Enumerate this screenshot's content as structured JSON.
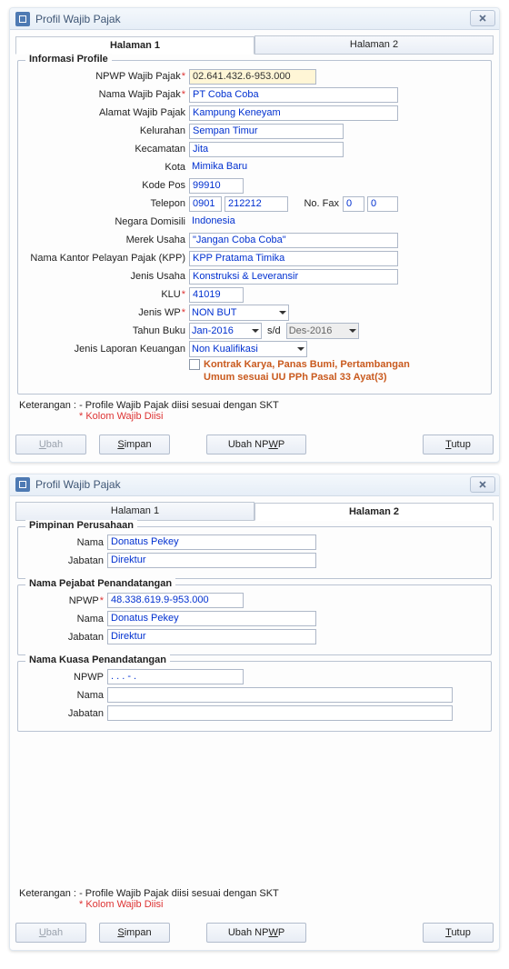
{
  "windowTitle": "Profil Wajib Pajak",
  "tabs": {
    "tab1": "Halaman 1",
    "tab2": "Halaman 2"
  },
  "info": {
    "legend": "Informasi Profile",
    "labels": {
      "npwp": "NPWP Wajib Pajak",
      "nama": "Nama Wajib Pajak",
      "alamat": "Alamat Wajib Pajak",
      "kelurahan": "Kelurahan",
      "kecamatan": "Kecamatan",
      "kota": "Kota",
      "kodepos": "Kode Pos",
      "telepon": "Telepon",
      "nofax": "No. Fax",
      "negara": "Negara Domisili",
      "merek": "Merek Usaha",
      "kpp": "Nama Kantor Pelayan Pajak (KPP)",
      "jenisUsaha": "Jenis Usaha",
      "klu": "KLU",
      "jenisWp": "Jenis WP",
      "tahunBuku": "Tahun Buku",
      "sd": "s/d",
      "jlk": "Jenis Laporan Keuangan",
      "kontrak": "Kontrak Karya,  Panas Bumi, Pertambangan Umum sesuai UU PPh Pasal 33 Ayat(3)"
    },
    "values": {
      "npwp": "02.641.432.6-953.000",
      "nama": "PT Coba Coba",
      "alamat": "Kampung Keneyam",
      "kelurahan": "Sempan Timur",
      "kecamatan": "Jita",
      "kota": "Mimika Baru",
      "kodepos": "99910",
      "telArea": "0901",
      "telNum": "212212",
      "faxArea": "0",
      "faxNum": "0",
      "negara": "Indonesia",
      "merek": "\"Jangan Coba Coba\"",
      "kpp": "KPP Pratama Timika",
      "jenisUsaha": "Konstruksi & Leveransir",
      "klu": "41019",
      "jenisWp": "NON BUT",
      "tbStart": "Jan-2016",
      "tbEnd": "Des-2016",
      "jlk": "Non Kualifikasi"
    }
  },
  "h2": {
    "pimpinan": {
      "legend": "Pimpinan Perusahaan",
      "labels": {
        "nama": "Nama",
        "jabatan": "Jabatan"
      },
      "values": {
        "nama": "Donatus Pekey",
        "jabatan": "Direktur"
      }
    },
    "pejabat": {
      "legend": "Nama Pejabat Penandatangan",
      "labels": {
        "npwp": "NPWP",
        "nama": "Nama",
        "jabatan": "Jabatan"
      },
      "values": {
        "npwp": "48.338.619.9-953.000",
        "nama": "Donatus Pekey",
        "jabatan": "Direktur"
      }
    },
    "kuasa": {
      "legend": "Nama Kuasa Penandatangan",
      "labels": {
        "npwp": "NPWP",
        "nama": "Nama",
        "jabatan": "Jabatan"
      },
      "values": {
        "npwp": "   .   .   .  -   .",
        "nama": "",
        "jabatan": ""
      }
    }
  },
  "ket": {
    "prefix": "Keterangan :",
    "line1": "- Profile Wajib Pajak diisi sesuai dengan SKT",
    "line2": "* Kolom Wajib Diisi"
  },
  "buttons": {
    "ubah": "Ubah",
    "simpan": "Simpan",
    "ubahNpwp": "Ubah NPWP",
    "tutup": "Tutup"
  }
}
